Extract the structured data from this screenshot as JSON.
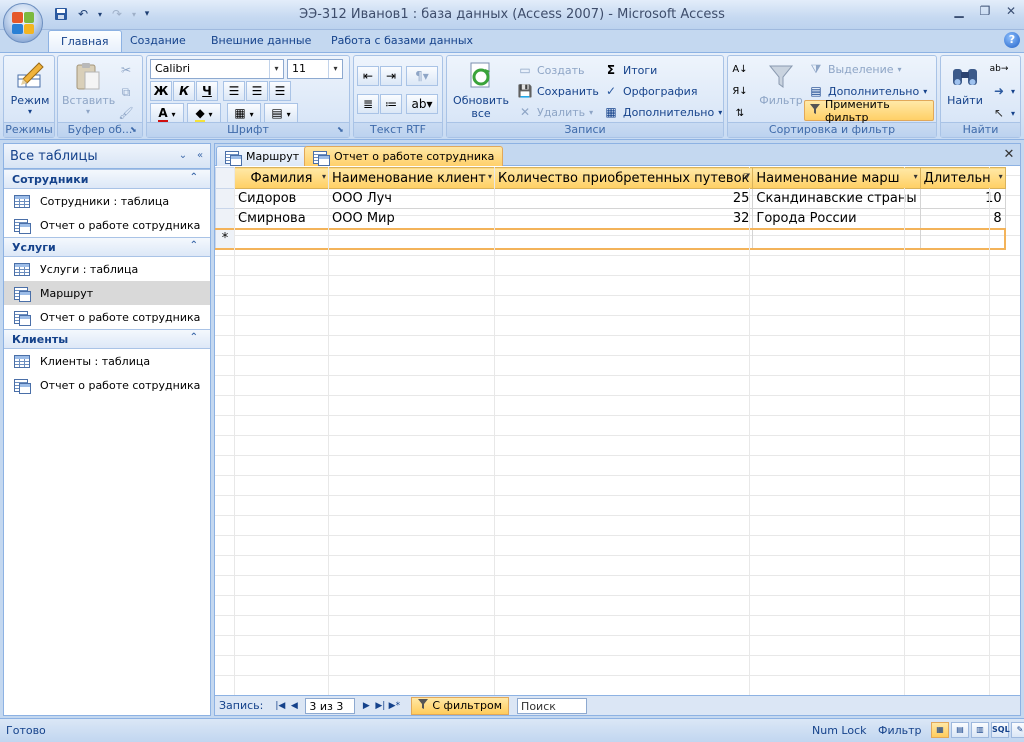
{
  "window": {
    "title": "ЭЭ-312 Иванов1 : база данных (Access 2007) - Microsoft Access"
  },
  "ribbon_tabs": [
    {
      "label": "Главная",
      "active": true
    },
    {
      "label": "Создание"
    },
    {
      "label": "Внешние данные"
    },
    {
      "label": "Работа с базами данных"
    }
  ],
  "ribbon": {
    "groups": {
      "views": "Режимы",
      "clipboard": "Буфер об...",
      "font": "Шрифт",
      "rtf": "Текст RTF",
      "records": "Записи",
      "sort_filter": "Сортировка и фильтр",
      "find": "Найти"
    },
    "view_button": "Режим",
    "paste_button": "Вставить",
    "font_name": "Calibri",
    "font_size": "11",
    "bold": "Ж",
    "italic": "К",
    "underline": "Ч",
    "refresh_button": "Обновить все",
    "new_record": "Создать",
    "save_record": "Сохранить",
    "delete_record": "Удалить",
    "totals": "Итоги",
    "spelling": "Орфография",
    "more_records": "Дополнительно",
    "filter_button": "Фильтр",
    "selection": "Выделение",
    "advanced": "Дополнительно",
    "apply_filter": "Применить фильтр",
    "find_button": "Найти"
  },
  "nav": {
    "header": "Все таблицы",
    "groups": [
      {
        "title": "Сотрудники",
        "items": [
          {
            "label": "Сотрудники : таблица",
            "kind": "table"
          },
          {
            "label": "Отчет о работе сотрудника",
            "kind": "query"
          }
        ]
      },
      {
        "title": "Услуги",
        "items": [
          {
            "label": "Услуги : таблица",
            "kind": "table"
          },
          {
            "label": "Маршрут",
            "kind": "query",
            "selected": true
          },
          {
            "label": "Отчет о работе сотрудника",
            "kind": "query"
          }
        ]
      },
      {
        "title": "Клиенты",
        "items": [
          {
            "label": "Клиенты : таблица",
            "kind": "table"
          },
          {
            "label": "Отчет о работе сотрудника",
            "kind": "query"
          }
        ]
      }
    ]
  },
  "doc_tabs": [
    {
      "label": "Маршрут"
    },
    {
      "label": "Отчет о работе сотрудника",
      "active": true
    }
  ],
  "datasheet": {
    "columns": [
      "Фамилия",
      "Наименование клиент",
      "Количество приобретенных путевок",
      "Наименование марш",
      "Длительн"
    ],
    "rows": [
      [
        "Сидоров",
        "ООО Луч",
        "25",
        "Скандинавские страны",
        "10"
      ],
      [
        "Смирнова",
        "ООО Мир",
        "32",
        "Города России",
        "8"
      ]
    ],
    "new_row_marker": "*"
  },
  "record_nav": {
    "label": "Запись:",
    "position": "3 из 3",
    "filter_label": "С фильтром",
    "search_placeholder": "Поиск"
  },
  "status": {
    "left": "Готово",
    "num_lock": "Num Lock",
    "filter": "Фильтр",
    "sql": "SQL"
  }
}
